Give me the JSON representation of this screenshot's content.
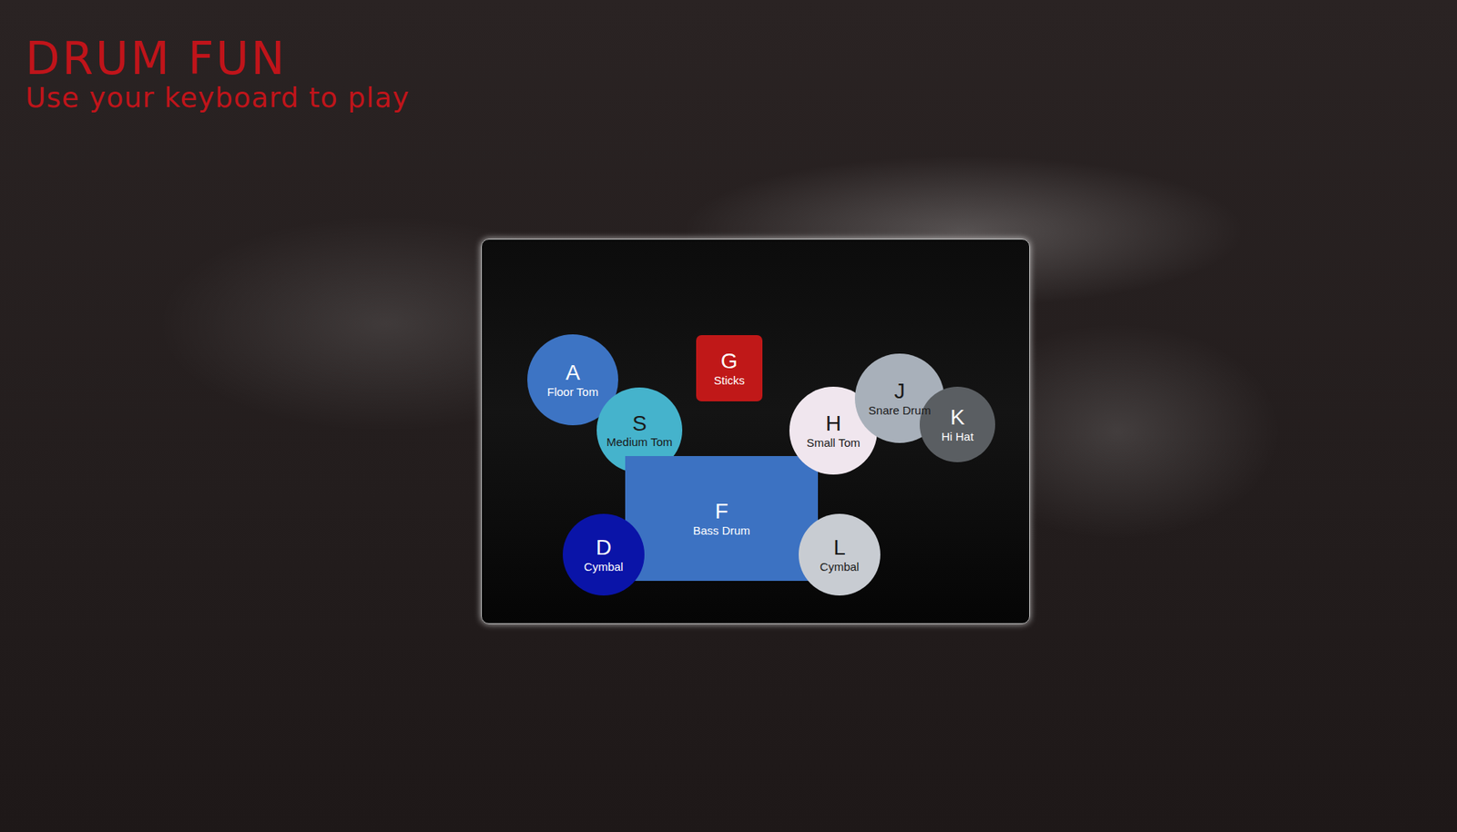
{
  "title": "DRUM FUN",
  "subtitle": "Use your keyboard to play",
  "pads": [
    {
      "key": "A",
      "label": "Floor Tom",
      "kind": "circle",
      "color": "#3d74c4"
    },
    {
      "key": "S",
      "label": "Medium Tom",
      "kind": "circle",
      "color": "#45b3cc"
    },
    {
      "key": "G",
      "label": "Sticks",
      "kind": "square",
      "color": "#c01818"
    },
    {
      "key": "F",
      "label": "Bass Drum",
      "kind": "rect",
      "color": "#3c72c2"
    },
    {
      "key": "D",
      "label": "Cymbal",
      "kind": "circle",
      "color": "#0a14a8"
    },
    {
      "key": "L",
      "label": "Cymbal",
      "kind": "circle",
      "color": "#c8ccd2"
    },
    {
      "key": "H",
      "label": "Small Tom",
      "kind": "circle",
      "color": "#f0e6ee"
    },
    {
      "key": "J",
      "label": "Snare Drum",
      "kind": "circle",
      "color": "#a8b0ba"
    },
    {
      "key": "K",
      "label": "Hi Hat",
      "kind": "circle",
      "color": "#5a5e62"
    }
  ]
}
